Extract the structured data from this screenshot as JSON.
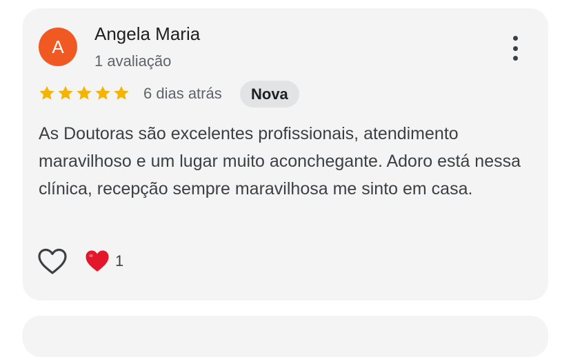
{
  "review": {
    "avatar_letter": "A",
    "avatar_color": "#f05a22",
    "author_name": "Angela Maria",
    "author_reviews": "1 avaliação",
    "rating": 5,
    "rating_max": 5,
    "star_color": "#f5b400",
    "date": "6 dias atrás",
    "badge": "Nova",
    "text": "As Doutoras são excelentes profissionais, atendimento maravilhoso e um lugar muito aconchegante. Adoro está nessa clínica, recepção sempre maravilhosa me sinto em casa.",
    "more_icon": "more-vert-icon",
    "like_icon": "heart-outline-icon",
    "reaction_icon": "red-heart-icon",
    "reaction_count": "1"
  }
}
